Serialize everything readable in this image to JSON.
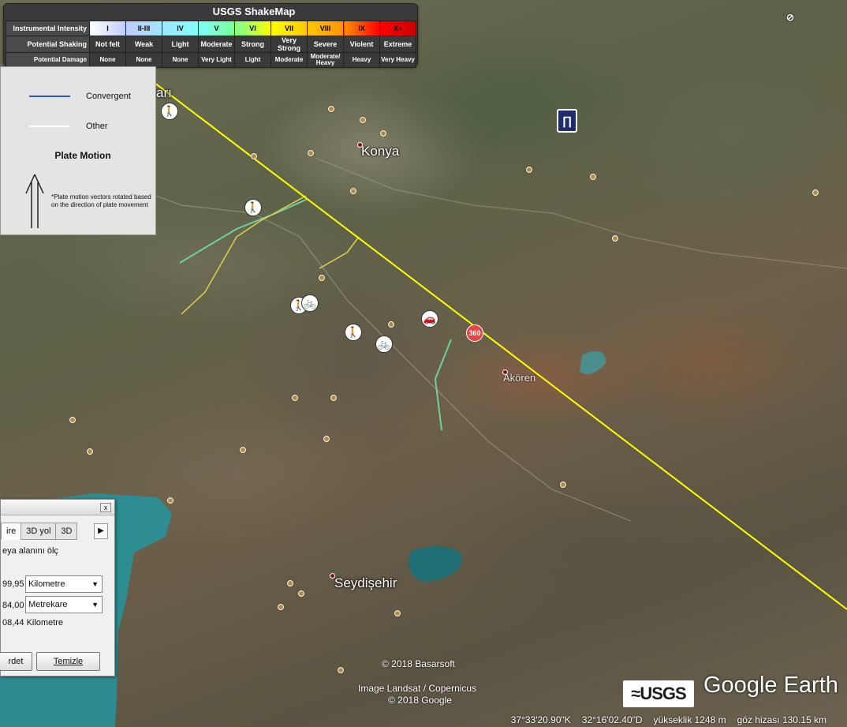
{
  "shakemap": {
    "title": "USGS ShakeMap",
    "row_labels": [
      "Instrumental Intensity",
      "Potential Shaking",
      "Potential Damage"
    ],
    "intensity": [
      "I",
      "II-III",
      "IV",
      "V",
      "VI",
      "VII",
      "VIII",
      "IX",
      "X+"
    ],
    "intensity_colors": [
      "#ffffff",
      "#bfccff",
      "#a0e6ff",
      "#80ffff",
      "#7aff93",
      "#ffff00",
      "#ffc800",
      "#ff9100",
      "#ff0000",
      "#c80000"
    ],
    "shaking": [
      "Not felt",
      "Weak",
      "Light",
      "Moderate",
      "Strong",
      "Very Strong",
      "Severe",
      "Violent",
      "Extreme"
    ],
    "damage": [
      "None",
      "None",
      "None",
      "Very Light",
      "Light",
      "Moderate",
      "Moderate/ Heavy",
      "Heavy",
      "Very Heavy"
    ]
  },
  "plate_legend": {
    "convergent_label": "Convergent",
    "convergent_color": "#2a5cc4",
    "other_label": "Other",
    "other_color": "#ffffff",
    "motion_title": "Plate Motion",
    "note": "*Plate motion vectors rotated based on the direction of plate movement"
  },
  "labels": {
    "konya": "Konya",
    "seydisehir": "Seydişehir",
    "akoren": "Akören",
    "partial_top_left": "arı"
  },
  "badge_360": "360",
  "measure_dialog": {
    "close": "x",
    "tabs": [
      "ire",
      "3D yol",
      "3D"
    ],
    "next_arrow": "▶",
    "description": "eya alanını ölç",
    "perimeter_value": "99,95",
    "perimeter_unit": "Kilometre",
    "area_value": "84,00",
    "area_unit": "Metrekare",
    "extra": "08,44 Kilometre",
    "save_button": "rdet",
    "clear_button": "Temizle"
  },
  "attribution": {
    "copyright1": "© 2018 Basarsoft",
    "imagery": "Image Landsat / Copernicus",
    "copyright2": "© 2018 Google",
    "usgs": "≈USGS",
    "google_earth": "Google Earth"
  },
  "status": {
    "lat": "37°33'20.90\"K",
    "lon": "32°16'02.40\"D",
    "elevation": "yükseklik  1248 m",
    "eye_alt": "göz hizası  130.15 km"
  },
  "colors": {
    "fault_line": "#ffff00",
    "lake": "#2a8f96",
    "green_fault": "#6fd19b"
  }
}
